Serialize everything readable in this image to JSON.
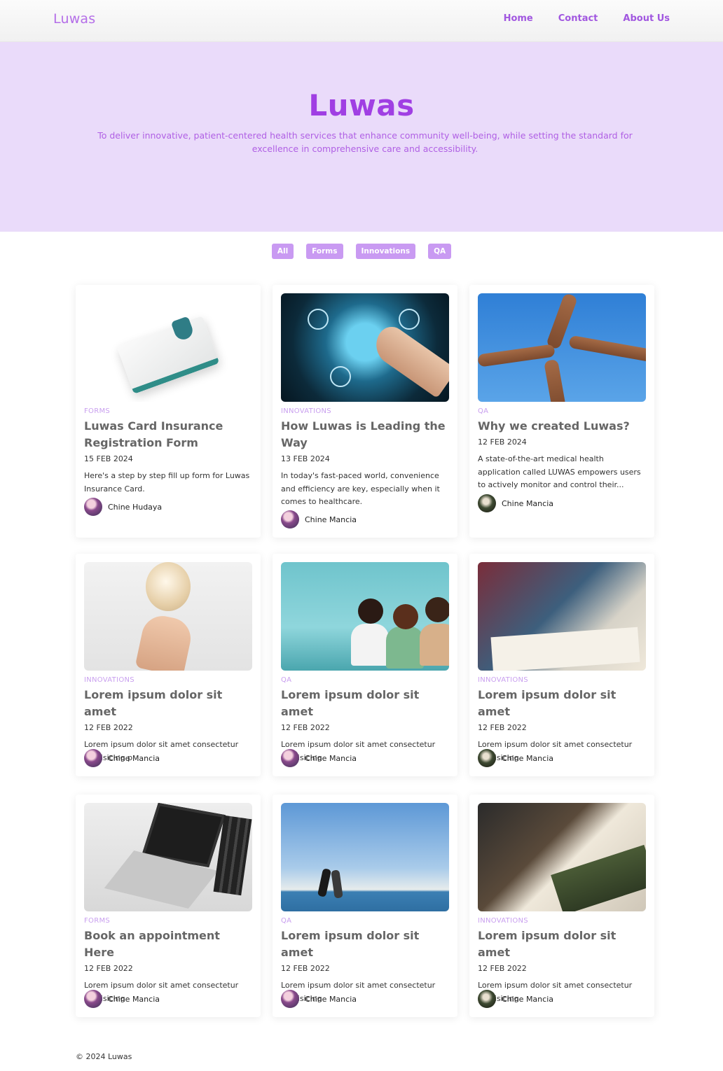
{
  "nav": {
    "brand": "Luwas",
    "links": [
      "Home",
      "Contact",
      "About Us"
    ]
  },
  "hero": {
    "title": "Luwas",
    "subtitle": "To deliver innovative, patient-centered health services that enhance community well-being, while setting the standard for excellence in comprehensive care and accessibility."
  },
  "filters": [
    "All",
    "Forms",
    "Innovations",
    "QA"
  ],
  "colors": {
    "accent": "#a03fe3",
    "hero_bg": "#eadbfa",
    "chip_bg": "#c99af2",
    "category": "#c9a0ef"
  },
  "cards": [
    {
      "category": "FORMS",
      "title": "Luwas Card Insurance Registration Form",
      "date": "15 FEB 2024",
      "excerpt": "Here's a step by step fill up form for Luwas Insurance Card.",
      "author": "Chine Hudaya",
      "image": "insurance-card-image"
    },
    {
      "category": "INNOVATIONS",
      "title": "How Luwas is Leading the Way",
      "date": "13 FEB 2024",
      "excerpt": "In today's fast-paced world, convenience and efficiency are key, especially when it comes to healthcare.",
      "author": "Chine Mancia",
      "image": "digital-globe-image"
    },
    {
      "category": "QA",
      "title": "Why we created Luwas?",
      "date": "12 FEB 2024",
      "excerpt": "A state-of-the-art medical health application called LUWAS empowers users to actively monitor and control their...",
      "author": "Chine Mancia",
      "image": "fist-bump-sky-image"
    },
    {
      "category": "INNOVATIONS",
      "title": "Lorem ipsum dolor sit amet",
      "date": "12 FEB 2022",
      "excerpt": "Lorem ipsum dolor sit amet consectetur adipisicing p",
      "author": "Chine Mancia",
      "image": "lightbulb-image"
    },
    {
      "category": "QA",
      "title": "Lorem ipsum dolor sit amet",
      "date": "12 FEB 2022",
      "excerpt": "Lorem ipsum dolor sit amet consectetur adipisicing",
      "author": "Chine Mancia",
      "image": "women-laptop-image"
    },
    {
      "category": "INNOVATIONS",
      "title": "Lorem ipsum dolor sit amet",
      "date": "12 FEB 2022",
      "excerpt": "Lorem ipsum dolor sit amet consectetur adipisicing",
      "author": "Chine Mancia",
      "image": "team-planning-image"
    },
    {
      "category": "FORMS",
      "title": "Book an appointment Here",
      "date": "12 FEB 2022",
      "excerpt": "Lorem ipsum dolor sit amet consectetur adipisicing",
      "author": "Chine Mancia",
      "image": "laptop-typing-image"
    },
    {
      "category": "QA",
      "title": "Lorem ipsum dolor sit amet",
      "date": "12 FEB 2022",
      "excerpt": "Lorem ipsum dolor sit amet consectetur adipisicing",
      "author": "Chine Mancia",
      "image": "beach-running-image"
    },
    {
      "category": "INNOVATIONS",
      "title": "Lorem ipsum dolor sit amet",
      "date": "12 FEB 2022",
      "excerpt": "Lorem ipsum dolor sit amet consectetur adipisicing",
      "author": "Chine Mancia",
      "image": "circuit-board-image"
    }
  ],
  "footer": "© 2024 Luwas"
}
